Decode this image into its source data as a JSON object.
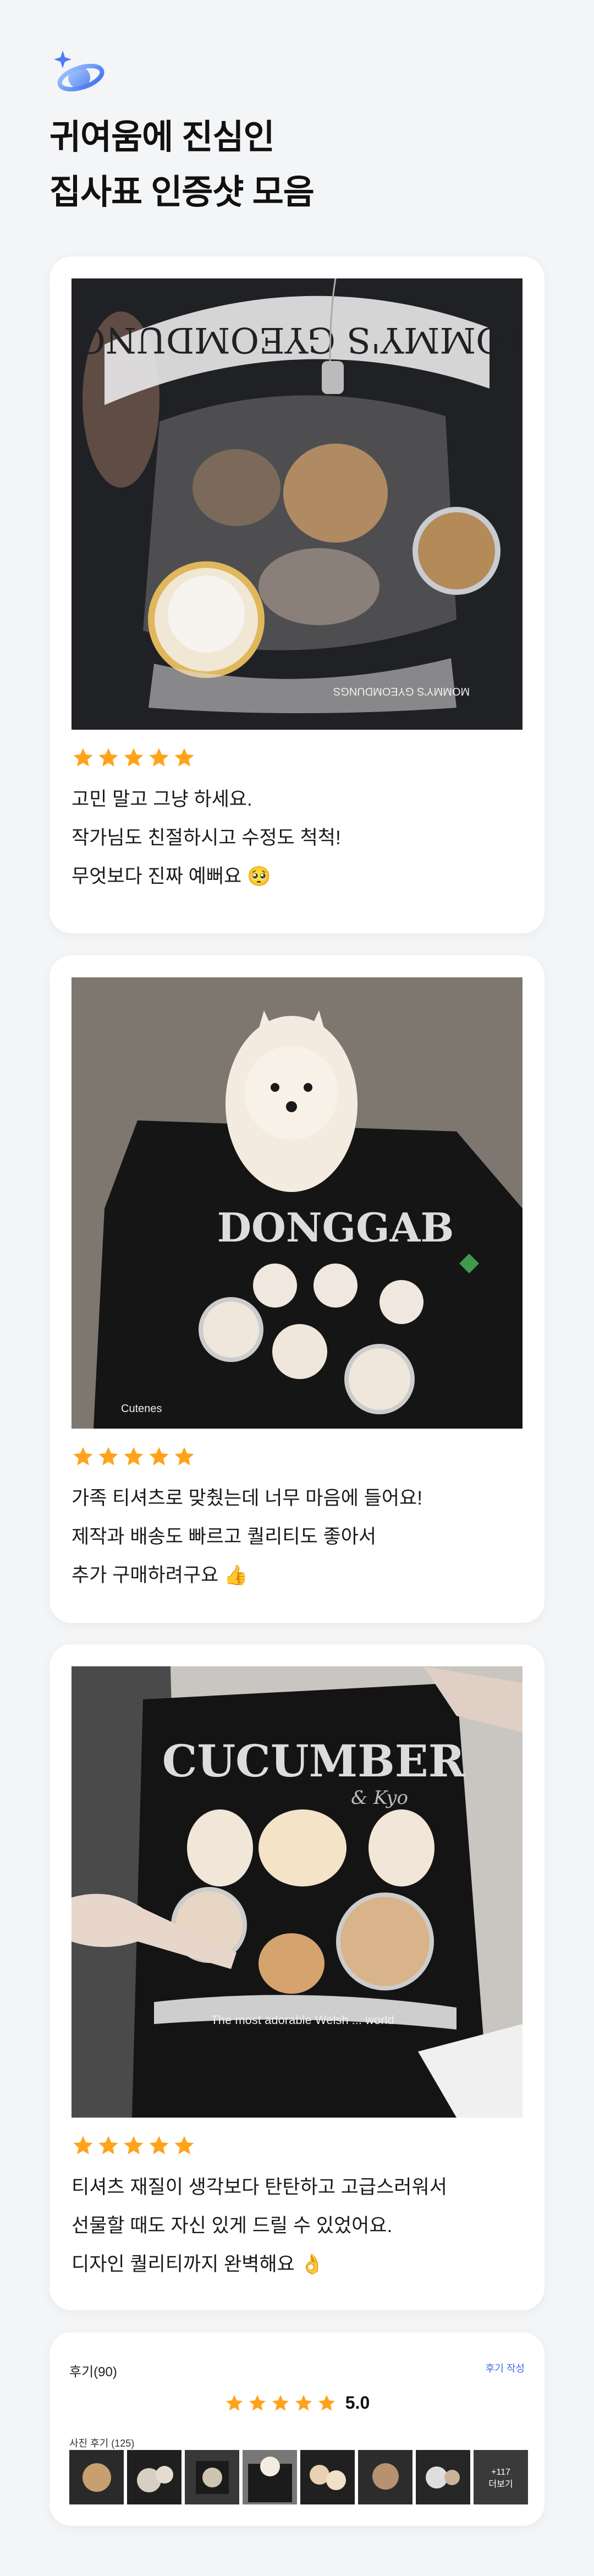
{
  "header": {
    "title_line1": "귀여움에 진심인",
    "title_line2": "집사표 인증샷 모음",
    "logo_icon": "sparkle-ring-icon"
  },
  "reviews": [
    {
      "rating": 5,
      "lines": [
        "고민 말고 그냥 하세요.",
        "작가님도 친절하시고 수정도 척척!",
        "무엇보다 진짜 예뻐요 🥺"
      ],
      "photo_shirt_title": "MOMMY'S GYEOMDUNGS",
      "photo_shirt_footer": "MOMMY'S GYEOMDUNGS"
    },
    {
      "rating": 5,
      "lines": [
        "가족 티셔츠로 맞췄는데 너무 마음에 들어요!",
        "제작과 배송도 빠르고 퀄리티도 좋아서",
        "추가 구매하려구요 👍"
      ],
      "photo_shirt_title": "DONGGAB",
      "photo_shirt_footer": "Cutenes"
    },
    {
      "rating": 5,
      "lines": [
        "티셔츠 재질이 생각보다 탄탄하고 고급스러워서",
        "선물할 때도 자신 있게 드릴 수 있었어요.",
        "디자인 퀄리티까지 완벽해요 👌"
      ],
      "photo_shirt_title": "CUCUMBER",
      "photo_shirt_sub": "& Kyo",
      "photo_shirt_footer": "The most adorable Welsh ... world"
    }
  ],
  "summary": {
    "review_label": "후기(90)",
    "write_label": "후기 작성",
    "score": "5.0",
    "photo_label": "사진 후기 (125)",
    "more_label": "+117",
    "more_sub": "더보기"
  },
  "colors": {
    "star": "#ffa31a",
    "accent_blue": "#3d6ef0",
    "background": "#f4f5f7"
  }
}
